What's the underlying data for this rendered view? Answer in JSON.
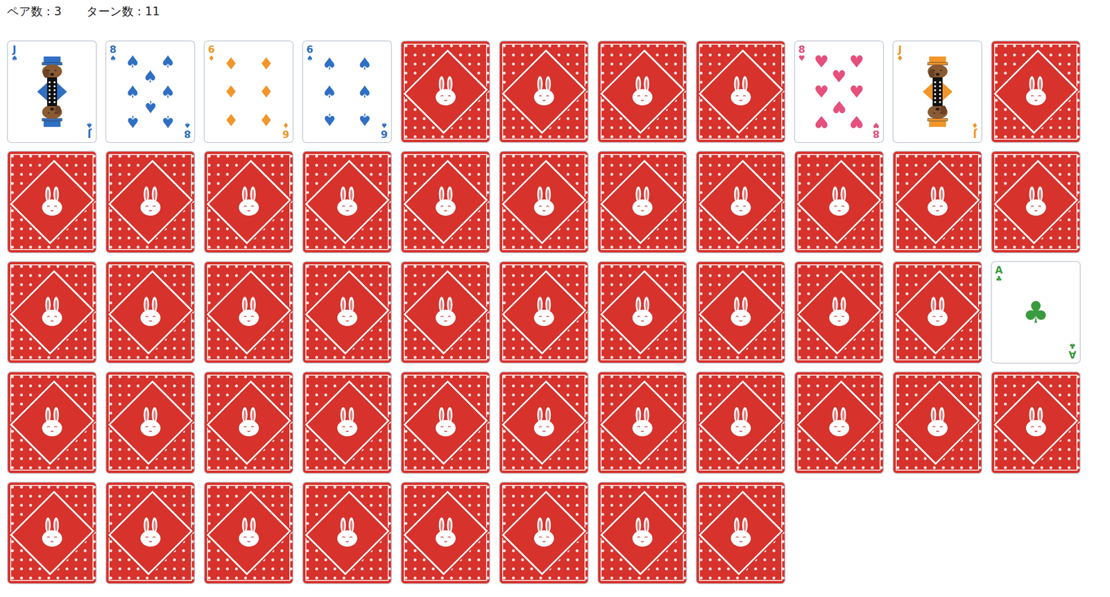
{
  "status": {
    "pairs": "ペア数：3",
    "turns": "ターン数：11"
  },
  "cards": [
    {
      "kind": "court",
      "face_up": true,
      "rank": "J",
      "suit": "♠",
      "color": "#2f6fc4"
    },
    {
      "kind": "pip",
      "face_up": true,
      "rank": "8",
      "suit": "♠",
      "color": "#2f6fc4"
    },
    {
      "kind": "pip",
      "face_up": true,
      "rank": "6",
      "suit": "♦",
      "color": "#f0962a"
    },
    {
      "kind": "pip",
      "face_up": true,
      "rank": "6",
      "suit": "♠",
      "color": "#2f6fc4"
    },
    {
      "kind": "back",
      "face_up": false
    },
    {
      "kind": "back",
      "face_up": false
    },
    {
      "kind": "back",
      "face_up": false
    },
    {
      "kind": "back",
      "face_up": false
    },
    {
      "kind": "pip",
      "face_up": true,
      "rank": "8",
      "suit": "♥",
      "color": "#e6507c"
    },
    {
      "kind": "court",
      "face_up": true,
      "rank": "J",
      "suit": "♦",
      "color": "#f0962a"
    },
    {
      "kind": "back",
      "face_up": false
    },
    {
      "kind": "back",
      "face_up": false
    },
    {
      "kind": "back",
      "face_up": false
    },
    {
      "kind": "back",
      "face_up": false
    },
    {
      "kind": "back",
      "face_up": false
    },
    {
      "kind": "back",
      "face_up": false
    },
    {
      "kind": "back",
      "face_up": false
    },
    {
      "kind": "back",
      "face_up": false
    },
    {
      "kind": "back",
      "face_up": false
    },
    {
      "kind": "back",
      "face_up": false
    },
    {
      "kind": "back",
      "face_up": false
    },
    {
      "kind": "back",
      "face_up": false
    },
    {
      "kind": "back",
      "face_up": false
    },
    {
      "kind": "back",
      "face_up": false
    },
    {
      "kind": "back",
      "face_up": false
    },
    {
      "kind": "back",
      "face_up": false
    },
    {
      "kind": "back",
      "face_up": false
    },
    {
      "kind": "back",
      "face_up": false
    },
    {
      "kind": "back",
      "face_up": false
    },
    {
      "kind": "back",
      "face_up": false
    },
    {
      "kind": "back",
      "face_up": false
    },
    {
      "kind": "back",
      "face_up": false
    },
    {
      "kind": "pip",
      "face_up": true,
      "rank": "A",
      "suit": "♣",
      "color": "#3a9a3e"
    },
    {
      "kind": "back",
      "face_up": false
    },
    {
      "kind": "back",
      "face_up": false
    },
    {
      "kind": "back",
      "face_up": false
    },
    {
      "kind": "back",
      "face_up": false
    },
    {
      "kind": "back",
      "face_up": false
    },
    {
      "kind": "back",
      "face_up": false
    },
    {
      "kind": "back",
      "face_up": false
    },
    {
      "kind": "back",
      "face_up": false
    },
    {
      "kind": "back",
      "face_up": false
    },
    {
      "kind": "back",
      "face_up": false
    },
    {
      "kind": "back",
      "face_up": false
    },
    {
      "kind": "back",
      "face_up": false
    },
    {
      "kind": "back",
      "face_up": false
    },
    {
      "kind": "back",
      "face_up": false
    },
    {
      "kind": "back",
      "face_up": false
    },
    {
      "kind": "back",
      "face_up": false
    },
    {
      "kind": "back",
      "face_up": false
    },
    {
      "kind": "back",
      "face_up": false
    },
    {
      "kind": "back",
      "face_up": false
    }
  ]
}
